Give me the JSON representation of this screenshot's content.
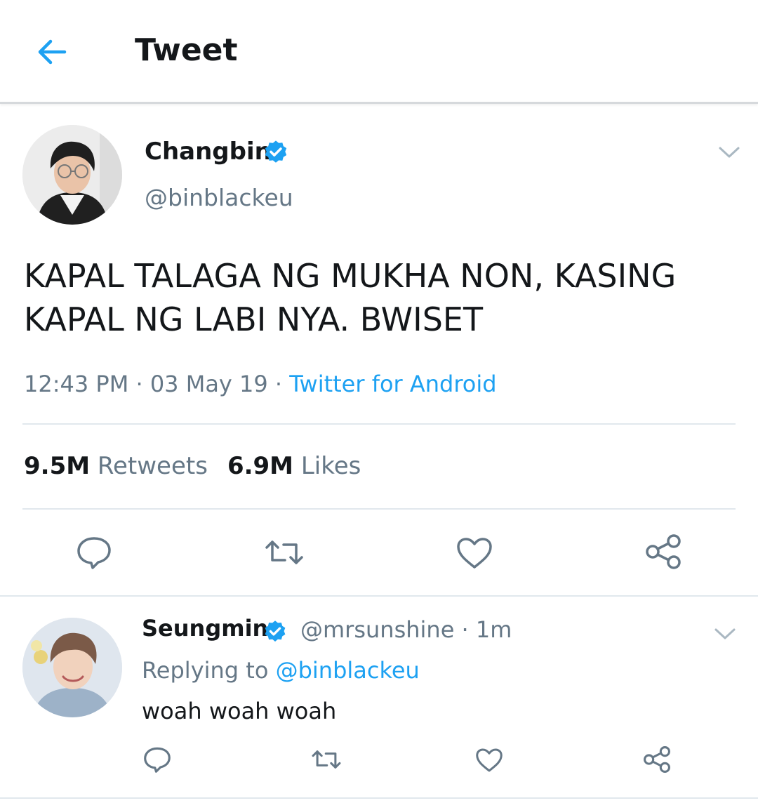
{
  "header": {
    "title": "Tweet",
    "back_icon": "arrow-left-icon",
    "accent_color": "#1da1f2"
  },
  "tweet": {
    "author_name": "Changbin",
    "author_handle": "@binblackeu",
    "verified": true,
    "text_line1": "KAPAL TALAGA NG MUKHA NON, KASING",
    "text_line2": "KAPAL NG LABI NYA. BWISET",
    "time": "12:43 PM",
    "date": "03 May 19",
    "source": "Twitter for Android",
    "separator": "·",
    "retweets_count": "9.5M",
    "retweets_label": "Retweets",
    "likes_count": "6.9M",
    "likes_label": "Likes"
  },
  "reply": {
    "author_name": "Seungmin",
    "author_handle": "@mrsunshine",
    "separator": "·",
    "age": "1m",
    "replying_label": "Replying to",
    "replying_to": "@binblackeu",
    "text": "woah woah woah"
  },
  "colors": {
    "text_primary": "#14171a",
    "text_secondary": "#657786",
    "link": "#1da1f2",
    "divider": "#e1e8ed"
  }
}
